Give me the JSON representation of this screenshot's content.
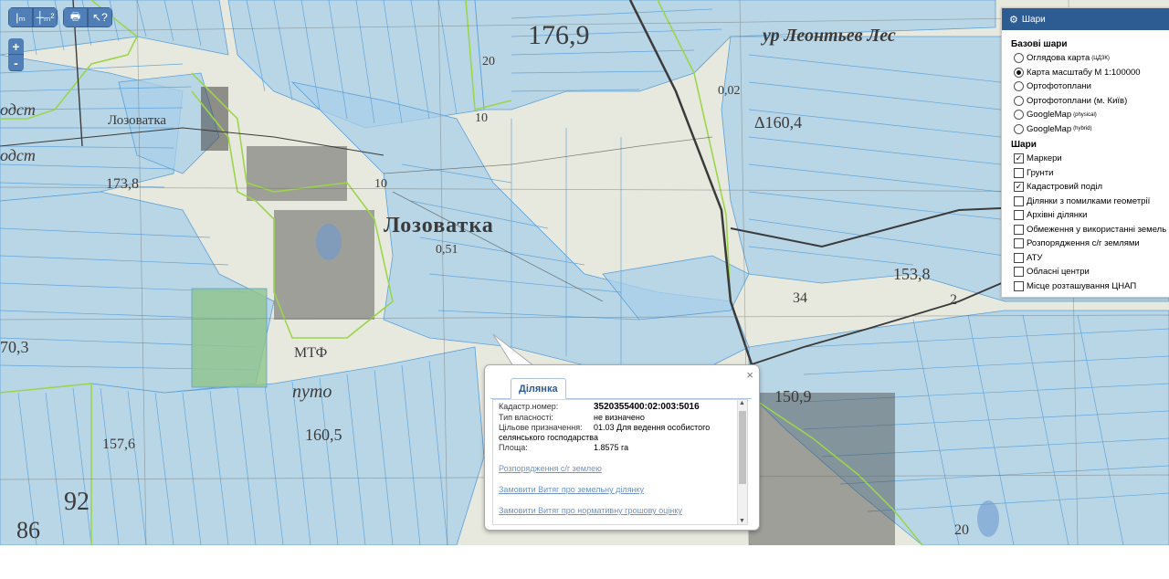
{
  "toolbar": {
    "buttons": [
      {
        "icon": "measure-length-icon",
        "glyph": "|ₘ"
      },
      {
        "icon": "measure-area-icon",
        "glyph": "┼ₘ²"
      },
      {
        "icon": "print-icon",
        "glyph": "🖶"
      },
      {
        "icon": "info-cursor-icon",
        "glyph": "↖?"
      }
    ]
  },
  "zoom": {
    "in": "+",
    "out": "-"
  },
  "map": {
    "labels": {
      "village": "Лозоватка",
      "village_small": "Лозоватка",
      "tract": "ур Леонтьев Лес",
      "elev_1769": "176,9",
      "elev_1604": "Δ160,4",
      "elev_1738": "173,8",
      "elev_1538": "153,8",
      "elev_1605": "160,5",
      "elev_1509": "150,9",
      "elev_1576": "157,6",
      "elev_703": "70,3",
      "n92": "92",
      "n86": "86",
      "v051": "0,51",
      "v002": "0,02",
      "mtf": "МТФ",
      "putnya": "путо",
      "n20a": "20",
      "n20b": "20",
      "n10a": "10",
      "n10b": "10",
      "n34": "34",
      "n2": "2",
      "odst1": "одст",
      "odst2": "одст"
    }
  },
  "layers_panel": {
    "title": "Шари",
    "base_title": "Базові шари",
    "base_layers": [
      {
        "label": "Оглядова карта",
        "sup": "(ЦДЗК)",
        "selected": false
      },
      {
        "label": "Карта масштабу М 1:100000",
        "sup": "",
        "selected": true
      },
      {
        "label": "Ортофотоплани",
        "sup": "",
        "selected": false
      },
      {
        "label": "Ортофотоплани (м. Київ)",
        "sup": "",
        "selected": false
      },
      {
        "label": "GoogleMap",
        "sup": "(physical)",
        "selected": false
      },
      {
        "label": "GoogleMap",
        "sup": "(hybrid)",
        "selected": false
      }
    ],
    "overlay_title": "Шари",
    "overlays": [
      {
        "label": "Маркери",
        "checked": true
      },
      {
        "label": "Грунти",
        "checked": false
      },
      {
        "label": "Кадастровий поділ",
        "checked": true
      },
      {
        "label": "Ділянки з помилками геометрії",
        "checked": false
      },
      {
        "label": "Архівні ділянки",
        "checked": false
      },
      {
        "label": "Обмеження у використанні земель",
        "checked": false
      },
      {
        "label": "Розпорядження с/г землями",
        "checked": false
      },
      {
        "label": "АТУ",
        "checked": false
      },
      {
        "label": "Обласні центри",
        "checked": false
      },
      {
        "label": "Місце розташування ЦНАП",
        "checked": false
      }
    ]
  },
  "popup": {
    "tab": "Ділянка",
    "close": "×",
    "fields": {
      "cadastral_label": "Кадастр.номер:",
      "cadastral_value": "3520355400:02:003:5016",
      "ownership_label": "Тип власності:",
      "ownership_value": "не визначено",
      "purpose_label": "Цільове призначення:",
      "purpose_value": "01.03 Для ведення особистого",
      "purpose_cont": "селянського господарства",
      "area_label": "Площа:",
      "area_value": "1.8575 га"
    },
    "links": [
      "Розпорядження с/г землею",
      "Замовити Витяг про земельну ділянку",
      "Замовити Витяг про нормативну грошову оцінку"
    ]
  },
  "colors": {
    "parcel_fill": "#a9cfe8",
    "parcel_stroke": "#5aa0d8",
    "boundary": "#9bd54a",
    "road": "#3a3a3a",
    "panel_header": "#2d5c92",
    "button": "#4f7fb6"
  }
}
